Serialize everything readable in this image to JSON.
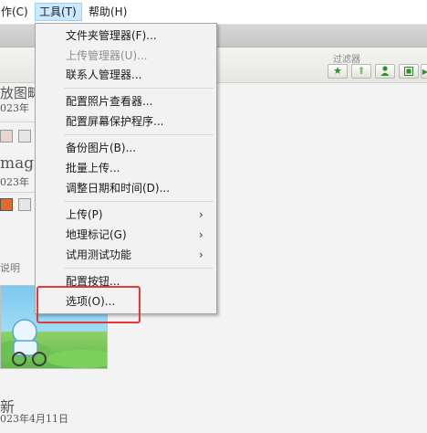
{
  "menubar": {
    "items": [
      {
        "label": "作(C)"
      },
      {
        "label": "工具(T)"
      },
      {
        "label": "帮助(H)"
      }
    ]
  },
  "filterbar": {
    "label": "过滤器",
    "buttons": [
      "star-icon",
      "up-arrow-icon",
      "person-icon",
      "film-icon",
      "play-icon"
    ]
  },
  "background": {
    "title_fragment_1": "放图畴",
    "date_fragment_1": "023年",
    "title_fragment_2": "mage",
    "date_fragment_2": "023年",
    "caption_fragment": "说明",
    "title_fragment_3": "新",
    "date_full": "023年4月11日"
  },
  "menu": {
    "items": [
      {
        "label": "文件夹管理器(F)...",
        "disabled": false
      },
      {
        "label": "上传管理器(U)...",
        "disabled": true
      },
      {
        "label": "联系人管理器...",
        "disabled": false
      },
      {
        "label": "配置照片查看器...",
        "disabled": false
      },
      {
        "label": "配置屏幕保护程序...",
        "disabled": false
      },
      {
        "label": "备份图片(B)...",
        "disabled": false
      },
      {
        "label": "批量上传...",
        "disabled": false
      },
      {
        "label": "调整日期和时间(D)...",
        "disabled": false
      },
      {
        "label": "上传(P)",
        "disabled": false,
        "submenu": true
      },
      {
        "label": "地理标记(G)",
        "disabled": false,
        "submenu": true
      },
      {
        "label": "试用测试功能",
        "disabled": false,
        "submenu": true
      },
      {
        "label": "配置按钮...",
        "disabled": false
      },
      {
        "label": "选项(O)...",
        "disabled": false
      }
    ],
    "submenu_arrow": "›"
  },
  "colors": {
    "highlight_border": "#e5383b",
    "menubar_active": "#cce8ff"
  }
}
